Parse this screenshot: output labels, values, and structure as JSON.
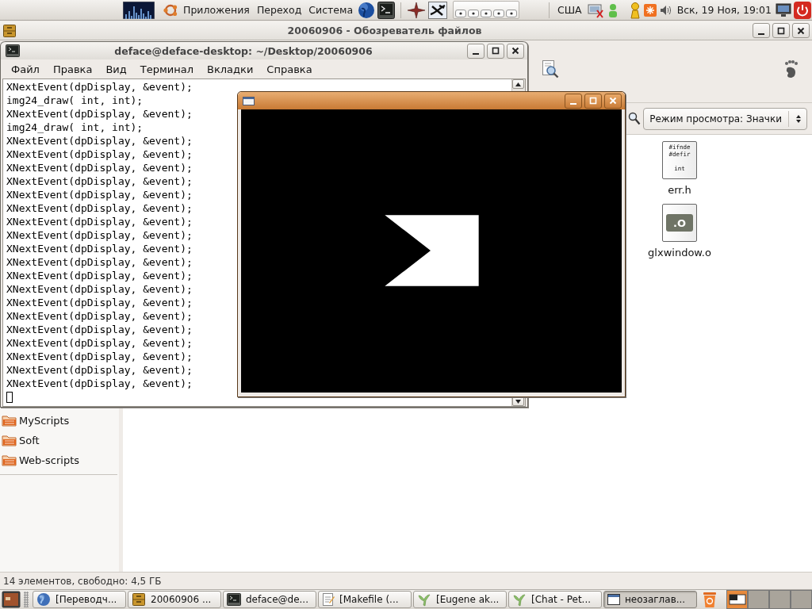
{
  "top_panel": {
    "menus": [
      "Приложения",
      "Переход",
      "Система"
    ],
    "keyboard_layout": "США",
    "clock": "Вск, 19 Ноя, 19:01"
  },
  "file_browser": {
    "title": "20060906 - Обозреватель файлов",
    "view_mode": "Режим просмотра: Значки",
    "sidebar_items": [
      "MyScripts",
      "Soft",
      "Web-scripts"
    ],
    "files": [
      {
        "name": "err.h",
        "kind": "header",
        "preview_lines": [
          "#ifnde",
          "#defir",
          "int"
        ]
      },
      {
        "name": "glxwindow.o",
        "kind": "object",
        "icon_label": ".O"
      }
    ],
    "status_bar": "14 элементов, свободно: 4,5 ГБ"
  },
  "terminal": {
    "title": "deface@deface-desktop: ~/Desktop/20060906",
    "menu": [
      "Файл",
      "Правка",
      "Вид",
      "Терминал",
      "Вкладки",
      "Справка"
    ],
    "lines": [
      "XNextEvent(dpDisplay, &event);",
      "img24_draw( int, int);",
      "XNextEvent(dpDisplay, &event);",
      "img24_draw( int, int);",
      "XNextEvent(dpDisplay, &event);",
      "XNextEvent(dpDisplay, &event);",
      "XNextEvent(dpDisplay, &event);",
      "XNextEvent(dpDisplay, &event);",
      "XNextEvent(dpDisplay, &event);",
      "XNextEvent(dpDisplay, &event);",
      "XNextEvent(dpDisplay, &event);",
      "XNextEvent(dpDisplay, &event);",
      "XNextEvent(dpDisplay, &event);",
      "XNextEvent(dpDisplay, &event);",
      "XNextEvent(dpDisplay, &event);",
      "XNextEvent(dpDisplay, &event);",
      "XNextEvent(dpDisplay, &event);",
      "XNextEvent(dpDisplay, &event);",
      "XNextEvent(dpDisplay, &event);",
      "XNextEvent(dpDisplay, &event);",
      "XNextEvent(dpDisplay, &event);",
      "XNextEvent(dpDisplay, &event);",
      "XNextEvent(dpDisplay, &event);"
    ]
  },
  "taskbar": {
    "tasks": [
      {
        "label": "[Переводч...",
        "kind": "browser",
        "selected": false
      },
      {
        "label": "20060906 ...",
        "kind": "files",
        "selected": false
      },
      {
        "label": "deface@de...",
        "kind": "terminal",
        "selected": false
      },
      {
        "label": "[Makefile (...",
        "kind": "editor",
        "selected": false
      },
      {
        "label": "[Eugene ak...",
        "kind": "chat",
        "selected": false
      },
      {
        "label": "[Chat - Pet...",
        "kind": "chat",
        "selected": false
      },
      {
        "label": "неозаглав...",
        "kind": "window",
        "selected": true
      }
    ]
  }
}
